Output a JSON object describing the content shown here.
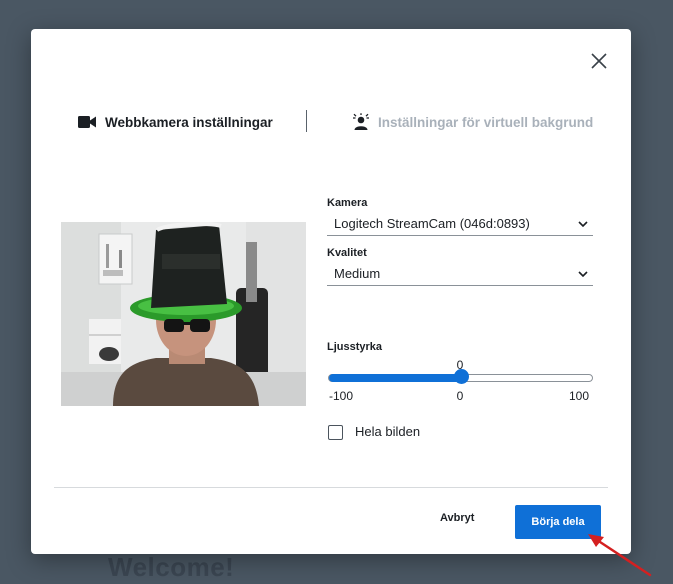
{
  "background": {
    "welcome_text": "Welcome!"
  },
  "dialog": {
    "tabs": [
      {
        "label": "Webbkamera inställningar",
        "icon": "video-camera-icon",
        "active": true
      },
      {
        "label": "Inställningar för virtuell bakgrund",
        "icon": "virtual-background-icon",
        "active": false
      }
    ],
    "camera": {
      "label": "Kamera",
      "value": "Logitech StreamCam (046d:0893)"
    },
    "quality": {
      "label": "Kvalitet",
      "value": "Medium"
    },
    "brightness": {
      "label": "Ljusstyrka",
      "current": "0",
      "min": "-100",
      "mid": "0",
      "max": "100",
      "fraction": 0.5
    },
    "fullframe": {
      "label": "Hela bilden",
      "checked": false
    },
    "buttons": {
      "cancel": "Avbryt",
      "primary": "Börja dela"
    }
  },
  "colors": {
    "accent": "#0f70d7",
    "annotation_arrow": "#d42020",
    "backdrop": "#4a5763"
  }
}
